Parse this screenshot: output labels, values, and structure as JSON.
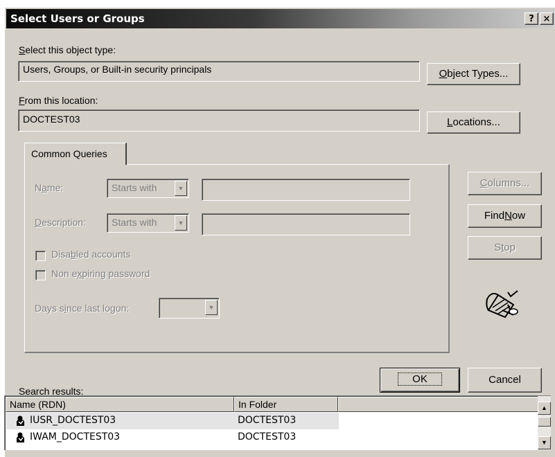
{
  "window": {
    "title": "Select Users or Groups",
    "help_button": "?",
    "close_button": "×"
  },
  "object_type": {
    "label": "Select this object type:",
    "value": "Users, Groups, or Built-in security principals",
    "button": "Object Types..."
  },
  "location": {
    "label": "From this location:",
    "value": "DOCTEST03",
    "button": "Locations..."
  },
  "queries": {
    "tab": "Common Queries",
    "name_label": "Name:",
    "name_mode": "Starts with",
    "name_value": "",
    "description_label": "Description:",
    "description_mode": "Starts with",
    "description_value": "",
    "disabled_accounts": "Disabled accounts",
    "non_expiring_password": "Non expiring password",
    "days_since_logon": "Days since last logon:",
    "days_value": ""
  },
  "side_buttons": {
    "columns": "Columns...",
    "find_now": "Find Now",
    "stop": "Stop"
  },
  "dialog_buttons": {
    "ok": "OK",
    "cancel": "Cancel"
  },
  "results": {
    "label": "Search results:",
    "columns": [
      "Name (RDN)",
      "In Folder"
    ],
    "rows": [
      {
        "name": "IUSR_DOCTEST03",
        "folder": "DOCTEST03",
        "icon": "user-icon"
      },
      {
        "name": "IWAM_DOCTEST03",
        "folder": "DOCTEST03",
        "icon": "user-icon"
      }
    ]
  }
}
